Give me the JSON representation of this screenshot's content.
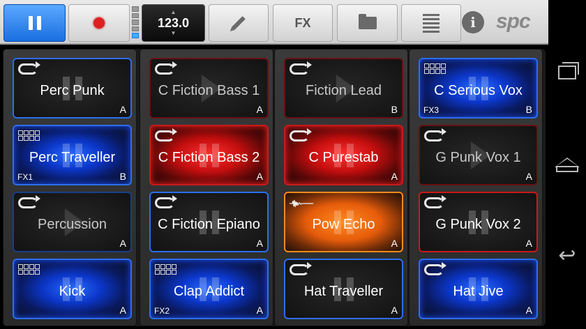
{
  "toolbar": {
    "bpm": "123.0",
    "bpm_up": "▲",
    "bpm_down": "▼",
    "fx_label": "FX",
    "info_label": "i",
    "logo": "spc"
  },
  "nav": {
    "back_glyph": "↩"
  },
  "colors": {
    "accent_blue": "#1a6fe0",
    "pad_blue": "#2c6ef0",
    "pad_red": "#c81a1a",
    "pad_orange": "#ff8a1a"
  },
  "pads": {
    "c0": [
      {
        "label": "Perc Punk",
        "tag": "A",
        "fx": ""
      },
      {
        "label": "Perc Traveller",
        "tag": "B",
        "fx": "FX1"
      },
      {
        "label": "Percussion",
        "tag": "A",
        "fx": ""
      },
      {
        "label": "Kick",
        "tag": "A",
        "fx": ""
      }
    ],
    "c1": [
      {
        "label": "C Fiction Bass 1",
        "tag": "A",
        "fx": ""
      },
      {
        "label": "C Fiction Bass 2",
        "tag": "A",
        "fx": ""
      },
      {
        "label": "C Fiction Epiano",
        "tag": "A",
        "fx": ""
      },
      {
        "label": "Clap Addict",
        "tag": "A",
        "fx": "FX2"
      }
    ],
    "c2": [
      {
        "label": "Fiction Lead",
        "tag": "B",
        "fx": ""
      },
      {
        "label": "C Purestab",
        "tag": "A",
        "fx": ""
      },
      {
        "label": "Pow Echo",
        "tag": "A",
        "fx": ""
      },
      {
        "label": "Hat Traveller",
        "tag": "A",
        "fx": ""
      }
    ],
    "c3": [
      {
        "label": "C Serious Vox",
        "tag": "B",
        "fx": "FX3"
      },
      {
        "label": "G Punk Vox 1",
        "tag": "A",
        "fx": ""
      },
      {
        "label": "G Punk Vox 2",
        "tag": "A",
        "fx": ""
      },
      {
        "label": "Hat Jive",
        "tag": "A",
        "fx": ""
      }
    ]
  }
}
